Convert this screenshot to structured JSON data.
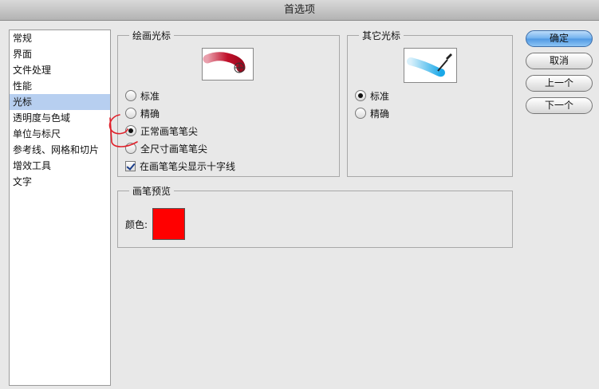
{
  "window": {
    "title": "首选项"
  },
  "sidebar": {
    "items": [
      {
        "label": "常规"
      },
      {
        "label": "界面"
      },
      {
        "label": "文件处理"
      },
      {
        "label": "性能"
      },
      {
        "label": "光标"
      },
      {
        "label": "透明度与色域"
      },
      {
        "label": "单位与标尺"
      },
      {
        "label": "参考线、网格和切片"
      },
      {
        "label": "增效工具"
      },
      {
        "label": "文字"
      }
    ],
    "selected_index": 4
  },
  "painting_cursors": {
    "legend": "绘画光标",
    "options": [
      {
        "label": "标准",
        "checked": false
      },
      {
        "label": "精确",
        "checked": false
      },
      {
        "label": "正常画笔笔尖",
        "checked": true
      },
      {
        "label": "全尺寸画笔笔尖",
        "checked": false
      }
    ],
    "crosshair_checkbox": {
      "label": "在画笔笔尖显示十字线",
      "checked": true
    }
  },
  "other_cursors": {
    "legend": "其它光标",
    "options": [
      {
        "label": "标准",
        "checked": true
      },
      {
        "label": "精确",
        "checked": false
      }
    ]
  },
  "brush_preview": {
    "legend": "画笔预览",
    "color_label": "颜色:",
    "color": "#ff0000"
  },
  "buttons": {
    "ok": "确定",
    "cancel": "取消",
    "prev": "上一个",
    "next": "下一个"
  },
  "colors": {
    "selection": "#b7cff0",
    "annotation": "#e0202a",
    "brush_stroke": "#c0102a",
    "eyedropper_stroke": "#1aa8e8"
  }
}
